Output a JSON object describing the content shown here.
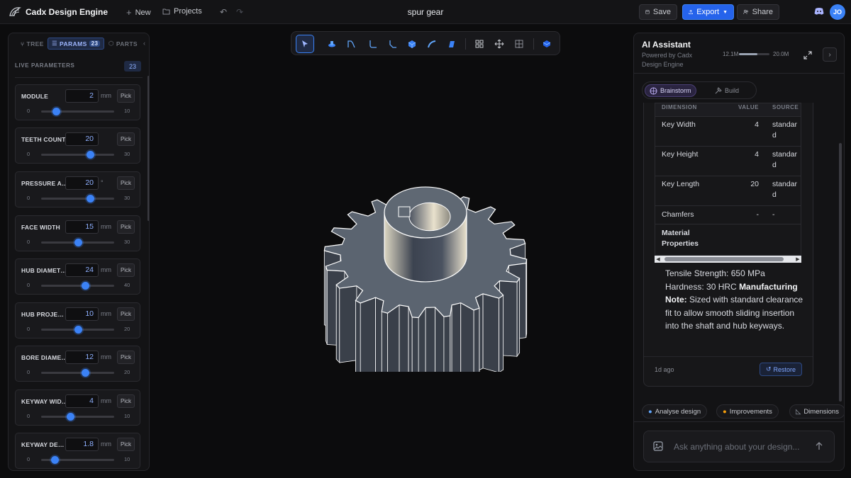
{
  "app": {
    "brand": "Cadx Design Engine",
    "new_label": "New",
    "projects_label": "Projects",
    "document_title": "spur gear",
    "save_label": "Save",
    "export_label": "Export",
    "share_label": "Share",
    "avatar_initials": "JO",
    "accent_color": "#3b82f6"
  },
  "left_panel": {
    "tabs": [
      {
        "label": "TREE",
        "icon": "tree-icon"
      },
      {
        "label": "PARAMS",
        "icon": "sliders-icon",
        "count": "23"
      },
      {
        "label": "PARTS",
        "icon": "cube-icon"
      }
    ],
    "section_title": "LIVE PARAMETERS",
    "param_count": "23",
    "pick_label": "Pick",
    "params": [
      {
        "label": "MODULE",
        "value": "2",
        "unit": "mm",
        "min": "0",
        "max": "10",
        "fraction": 0.2
      },
      {
        "label": "TEETH COUNT",
        "value": "20",
        "unit": "",
        "min": "0",
        "max": "30",
        "fraction": 0.6667
      },
      {
        "label": "PRESSURE ANGLE",
        "value": "20",
        "unit": "°",
        "min": "0",
        "max": "30",
        "fraction": 0.6667
      },
      {
        "label": "FACE WIDTH",
        "value": "15",
        "unit": "mm",
        "min": "0",
        "max": "30",
        "fraction": 0.5
      },
      {
        "label": "HUB DIAMETER",
        "value": "24",
        "unit": "mm",
        "min": "0",
        "max": "40",
        "fraction": 0.6
      },
      {
        "label": "HUB PROJECTION",
        "value": "10",
        "unit": "mm",
        "min": "0",
        "max": "20",
        "fraction": 0.5
      },
      {
        "label": "BORE DIAMETER",
        "value": "12",
        "unit": "mm",
        "min": "0",
        "max": "20",
        "fraction": 0.6
      },
      {
        "label": "KEYWAY WIDTH",
        "value": "4",
        "unit": "mm",
        "min": "0",
        "max": "10",
        "fraction": 0.4
      },
      {
        "label": "KEYWAY DEPTH",
        "value": "1.8",
        "unit": "mm",
        "min": "0",
        "max": "10",
        "fraction": 0.18
      }
    ]
  },
  "canvas_toolbar": {
    "tools": [
      "select-icon",
      "primitive-icon",
      "sketch-icon",
      "fillet-icon",
      "chamfer-icon",
      "extrude-icon",
      "sweep-icon",
      "loft-icon",
      "grid-view-icon",
      "move-icon",
      "section-icon",
      "cube-view-icon"
    ]
  },
  "ai_panel": {
    "title": "AI Assistant",
    "subtitle": "Powered by Cadx Design Engine",
    "tokens_used": "12.1M",
    "tokens_total": "20.0M",
    "tokens_fraction": 0.605,
    "modes": [
      {
        "label": "Brainstorm",
        "active": true
      },
      {
        "label": "Build",
        "active": false
      }
    ],
    "table": {
      "headers": [
        "DIMENSION",
        "VALUE",
        "SOURCE"
      ],
      "rows": [
        {
          "dimension": "Key Width",
          "value": "4",
          "source": "standard"
        },
        {
          "dimension": "Key Height",
          "value": "4",
          "source": "standard"
        },
        {
          "dimension": "Key Length",
          "value": "20",
          "source": "standard"
        },
        {
          "dimension": "Chamfers",
          "value": "-",
          "source": "-"
        }
      ],
      "section_row": "Material Properties"
    },
    "message": {
      "tensile": "Tensile Strength: 650 MPa",
      "hardness": "Hardness: 30 HRC",
      "note_label": "Manufacturing Note:",
      "note_text": "Sized with standard clearance fit to allow smooth sliding insertion into the shaft and hub keyways."
    },
    "timestamp": "1d ago",
    "restore_label": "Restore",
    "chips": [
      "Analyse design",
      "Improvements",
      "Dimensions"
    ],
    "input_placeholder": "Ask anything about your design..."
  }
}
